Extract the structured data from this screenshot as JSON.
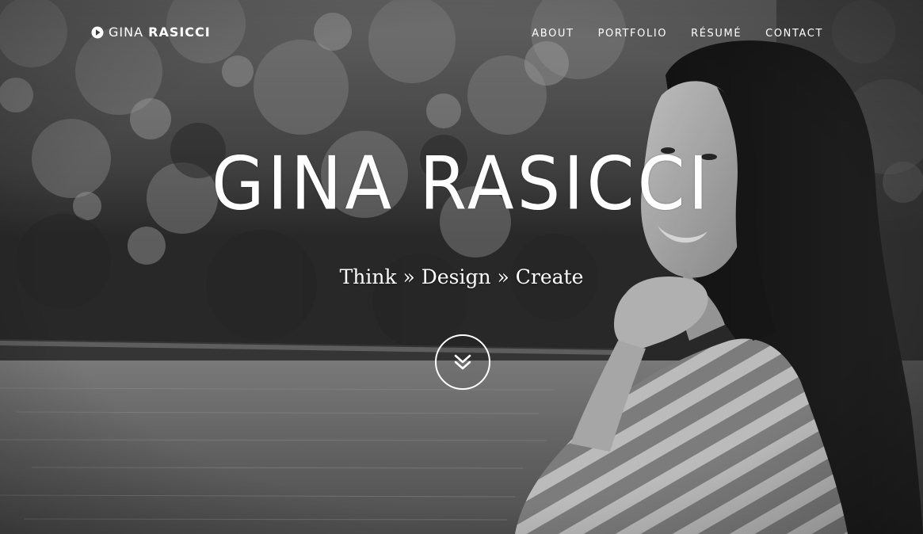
{
  "brand": {
    "first": "GINA",
    "last": "RASICCI",
    "icon": "play-circle-icon"
  },
  "nav": {
    "items": [
      {
        "label": "ABOUT"
      },
      {
        "label": "PORTFOLIO"
      },
      {
        "label": "RÉSUMÉ"
      },
      {
        "label": "CONTACT"
      }
    ]
  },
  "hero": {
    "title": "GINA RASICCI",
    "tagline": "Think » Design » Create",
    "scroll_icon": "double-chevron-down-icon"
  },
  "colors": {
    "text": "#ffffff",
    "overlay": "#000000"
  }
}
